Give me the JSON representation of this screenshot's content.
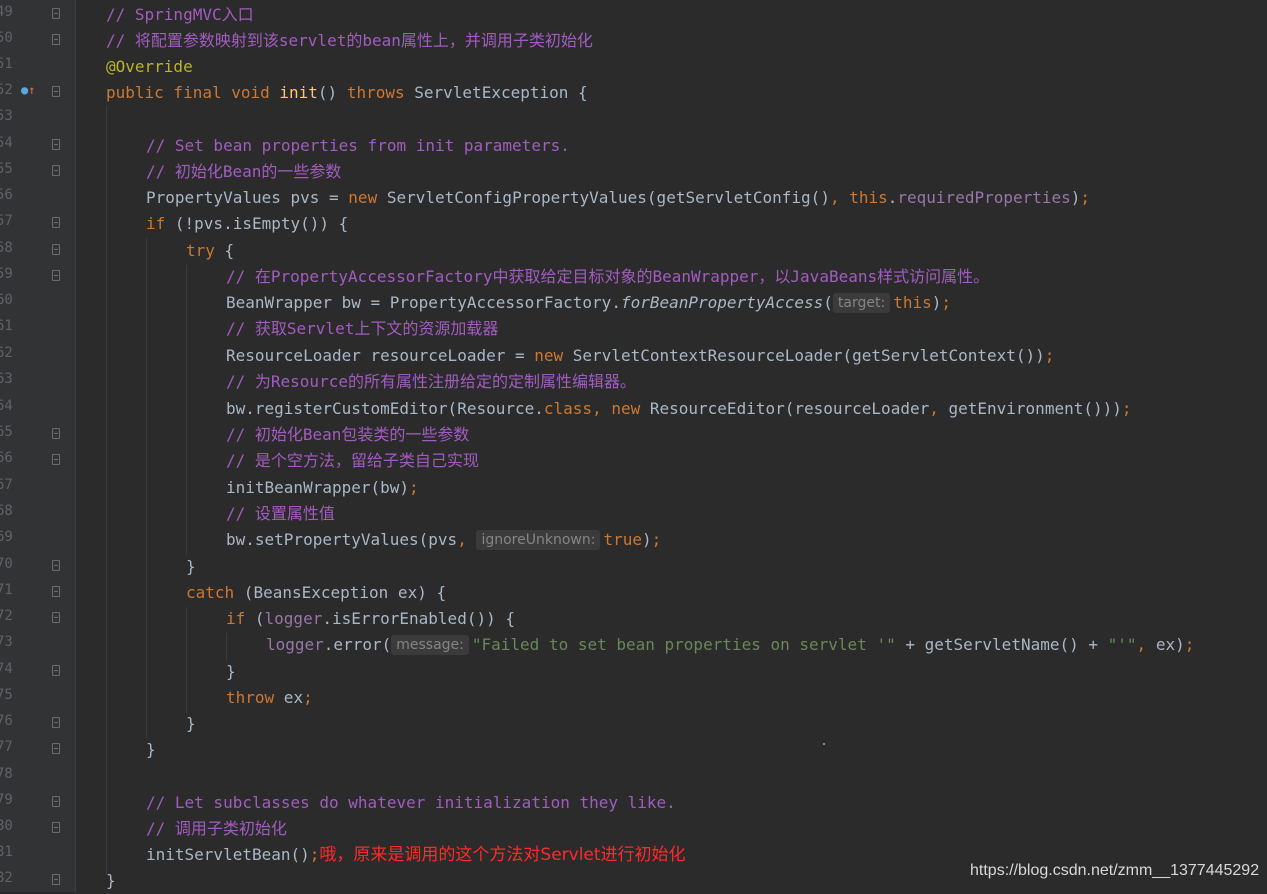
{
  "editor": {
    "line_numbers": [
      "49",
      "50",
      "51",
      "52",
      "53",
      "54",
      "55",
      "56",
      "57",
      "58",
      "59",
      "60",
      "61",
      "62",
      "63",
      "64",
      "65",
      "66",
      "67",
      "68",
      "69",
      "70",
      "71",
      "72",
      "73",
      "74",
      "75",
      "76",
      "77",
      "78",
      "79",
      "80",
      "81",
      "82"
    ],
    "l49": {
      "comment": "// SpringMVC入口"
    },
    "l50": {
      "comment": "// 将配置参数映射到该servlet的bean属性上，并调用子类初始化"
    },
    "l51": {
      "annotation": "@Override"
    },
    "l52": {
      "kw": "public final void ",
      "fn": "init",
      "rest1": "() ",
      "kw2": "throws",
      "rest2": " ServletException {"
    },
    "l54": {
      "comment": "// Set bean properties from init parameters."
    },
    "l55": {
      "comment": "// 初始化Bean的一些参数"
    },
    "l56": {
      "a": "PropertyValues pvs = ",
      "kw": "new",
      "b": " ServletConfigPropertyValues(getServletConfig()",
      "c": ", ",
      "kw2": "this",
      "d": ".",
      "fld": "requiredProperties",
      "e": ")",
      "f": ";"
    },
    "l57": {
      "kw": "if",
      "a": " (!pvs.isEmpty()) {"
    },
    "l58": {
      "kw": "try",
      "a": " {"
    },
    "l59": {
      "comment": "// 在PropertyAccessorFactory中获取给定目标对象的BeanWrapper，以JavaBeans样式访问属性。"
    },
    "l60": {
      "a": "BeanWrapper bw = PropertyAccessorFactory.",
      "it": "forBeanPropertyAccess",
      "b": "(",
      "hint": "target:",
      "kw": "this",
      "c": ")",
      "d": ";"
    },
    "l61": {
      "comment": "// 获取Servlet上下文的资源加载器"
    },
    "l62": {
      "a": "ResourceLoader resourceLoader = ",
      "kw": "new",
      "b": " ServletContextResourceLoader(getServletContext())",
      "c": ";"
    },
    "l63": {
      "comment": "// 为Resource的所有属性注册给定的定制属性编辑器。"
    },
    "l64": {
      "a": "bw.registerCustomEditor(Resource.",
      "kw": "class",
      "b": ", ",
      "kw2": "new",
      "c": " ResourceEditor(resourceLoader",
      "d": ", ",
      "e": "getEnvironment()))",
      "f": ";"
    },
    "l65": {
      "comment": "// 初始化Bean包装类的一些参数"
    },
    "l66": {
      "comment": "// 是个空方法，留给子类自己实现"
    },
    "l67": {
      "a": "initBeanWrapper(bw)",
      "b": ";"
    },
    "l68": {
      "comment": "// 设置属性值"
    },
    "l69": {
      "a": "bw.setPropertyValues(pvs",
      "b": ", ",
      "hint": "ignoreUnknown:",
      "kw": "true",
      "c": ")",
      "d": ";"
    },
    "l70": {
      "a": "}"
    },
    "l71": {
      "kw": "catch",
      "a": " (BeansException ex) {"
    },
    "l72": {
      "kw": "if",
      "a": " (",
      "fld": "logger",
      "b": ".isErrorEnabled()) {"
    },
    "l73": {
      "fld": "logger",
      "a": ".error(",
      "hint": "message:",
      "str": "\"Failed to set bean properties on servlet '\"",
      "b": " + getServletName() + ",
      "str2": "\"'\"",
      "c": ", ",
      "d": "ex)",
      "e": ";"
    },
    "l74": {
      "a": "}"
    },
    "l75": {
      "kw": "throw",
      "a": " ex",
      "b": ";"
    },
    "l76": {
      "a": "}"
    },
    "l77": {
      "a": "}"
    },
    "l79": {
      "comment": "// Let subclasses do whatever initialization they like."
    },
    "l80": {
      "comment": "// 调用子类初始化"
    },
    "l81": {
      "a": "initServletBean()",
      "b": ";",
      "note": "哦，原来是调用的这个方法对Servlet进行初始化"
    },
    "l82": {
      "a": "}"
    }
  },
  "watermark": "https://blog.csdn.net/zmm__1377445292",
  "colors": {
    "background": "#2b2b2b",
    "keyword": "#cc7832",
    "comment": "#a25cc0",
    "method_decl": "#ffc66d",
    "field": "#9876aa",
    "string": "#6a8759",
    "annotation": "#bbb529",
    "note": "#ff2a2a"
  }
}
